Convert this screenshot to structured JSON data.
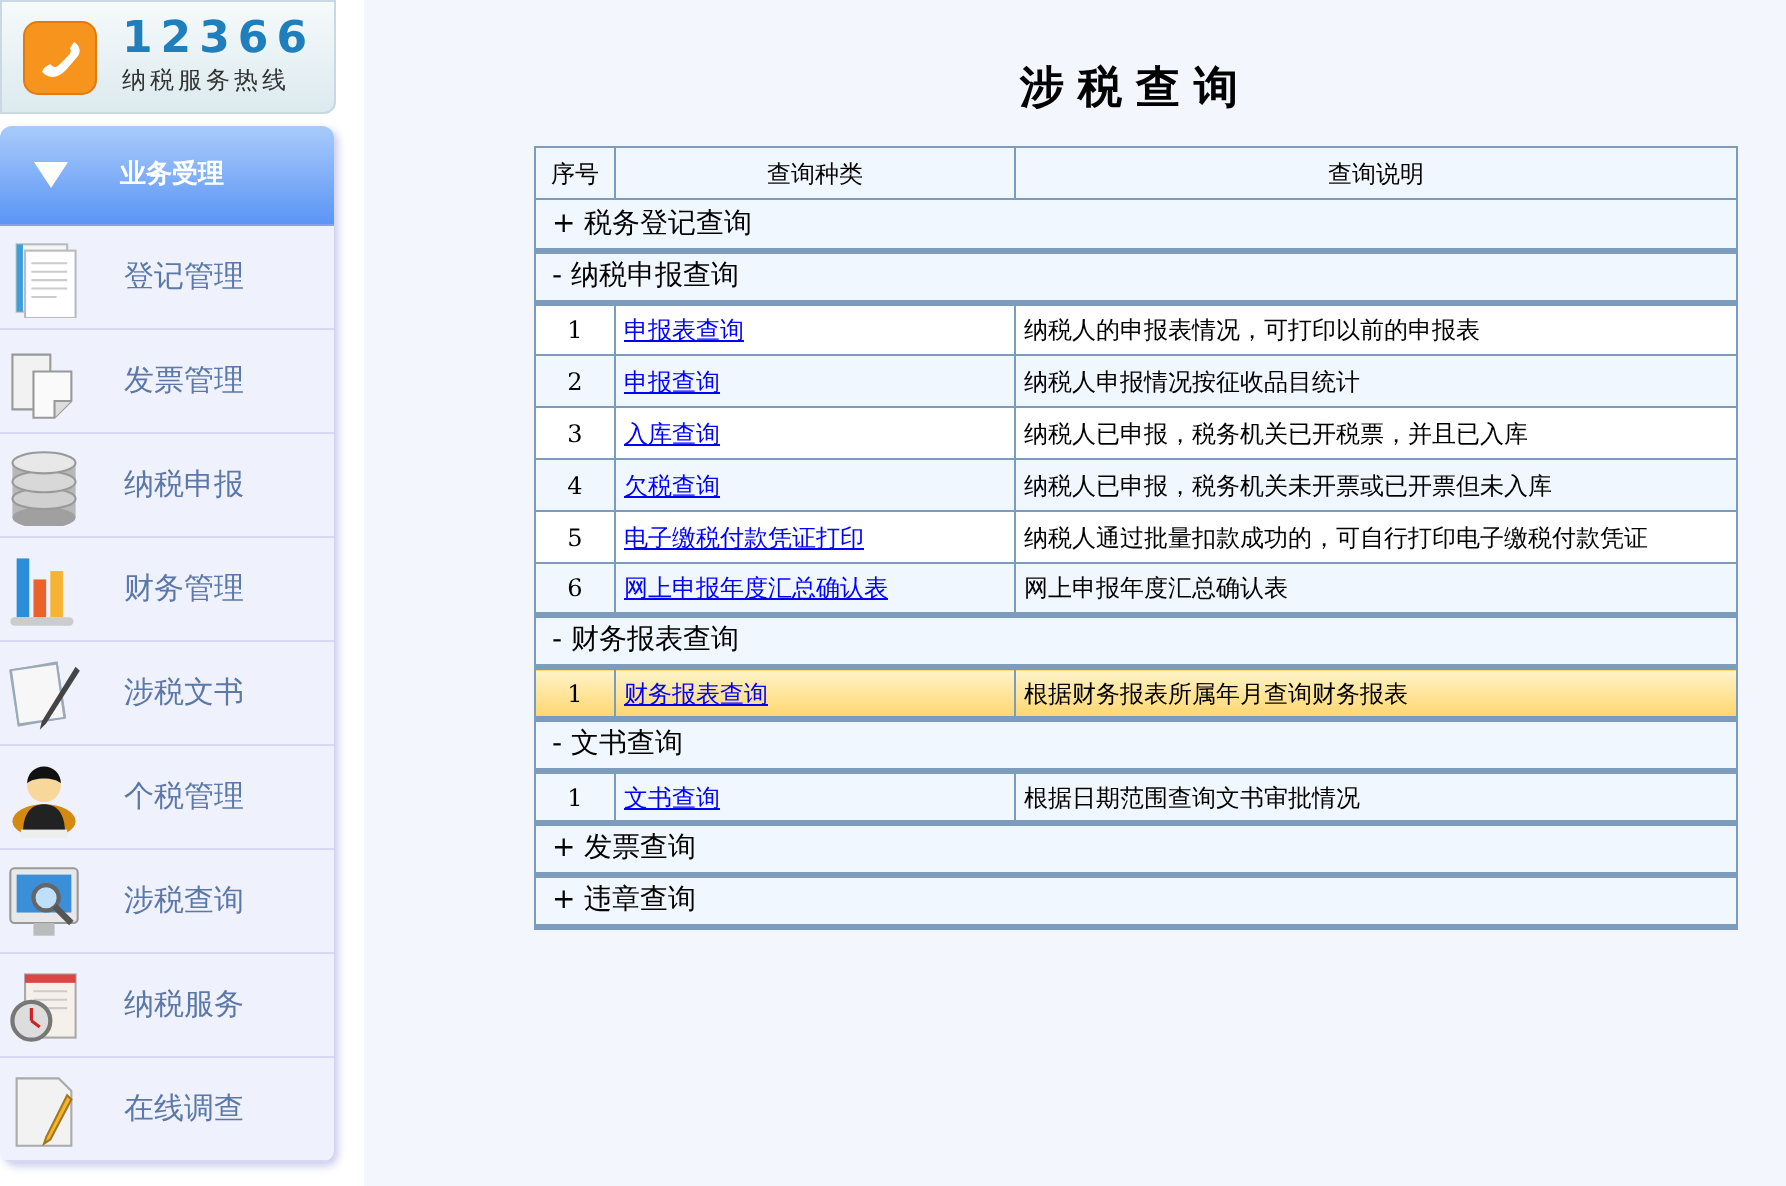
{
  "hotline": {
    "number": "12366",
    "caption": "纳税服务热线"
  },
  "sidebar": {
    "header": "业务受理",
    "expanded": true,
    "items": [
      {
        "label": "登记管理",
        "selected": false
      },
      {
        "label": "发票管理",
        "selected": false
      },
      {
        "label": "纳税申报",
        "selected": false
      },
      {
        "label": "财务管理",
        "selected": false
      },
      {
        "label": "涉税文书",
        "selected": false
      },
      {
        "label": "个税管理",
        "selected": false
      },
      {
        "label": "涉税查询",
        "selected": false
      },
      {
        "label": "纳税服务",
        "selected": false
      },
      {
        "label": "在线调查",
        "selected": false
      }
    ]
  },
  "page_title": "涉税查询",
  "table": {
    "columns": [
      "序号",
      "查询种类",
      "查询说明"
    ],
    "groups": [
      {
        "sign": "+",
        "title": "税务登记查询"
      },
      {
        "sign": "-",
        "title": "纳税申报查询",
        "rows": [
          {
            "index": "1",
            "link": "申报表查询",
            "description": "纳税人的申报表情况，可打印以前的申报表",
            "selected": false
          },
          {
            "index": "2",
            "link": "申报查询",
            "description": "纳税人申报情况按征收品目统计",
            "selected": false
          },
          {
            "index": "3",
            "link": "入库查询",
            "description": "纳税人已申报，税务机关已开税票，并且已入库",
            "selected": false
          },
          {
            "index": "4",
            "link": "欠税查询",
            "description": "纳税人已申报，税务机关未开票或已开票但未入库",
            "selected": false
          },
          {
            "index": "5",
            "link": "电子缴税付款凭证打印",
            "description": "纳税人通过批量扣款成功的，可自行打印电子缴税付款凭证",
            "selected": false
          },
          {
            "index": "6",
            "link": "网上申报年度汇总确认表",
            "description": "网上申报年度汇总确认表",
            "selected": false
          }
        ]
      },
      {
        "sign": "-",
        "title": "财务报表查询",
        "rows": [
          {
            "index": "1",
            "link": "财务报表查询",
            "description": "根据财务报表所属年月查询财务报表",
            "selected": true
          }
        ]
      },
      {
        "sign": "-",
        "title": "文书查询",
        "rows": [
          {
            "index": "1",
            "link": "文书查询",
            "description": "根据日期范围查询文书审批情况",
            "selected": false
          }
        ]
      },
      {
        "sign": "+",
        "title": "发票查询"
      },
      {
        "sign": "+",
        "title": "违章查询"
      }
    ]
  }
}
